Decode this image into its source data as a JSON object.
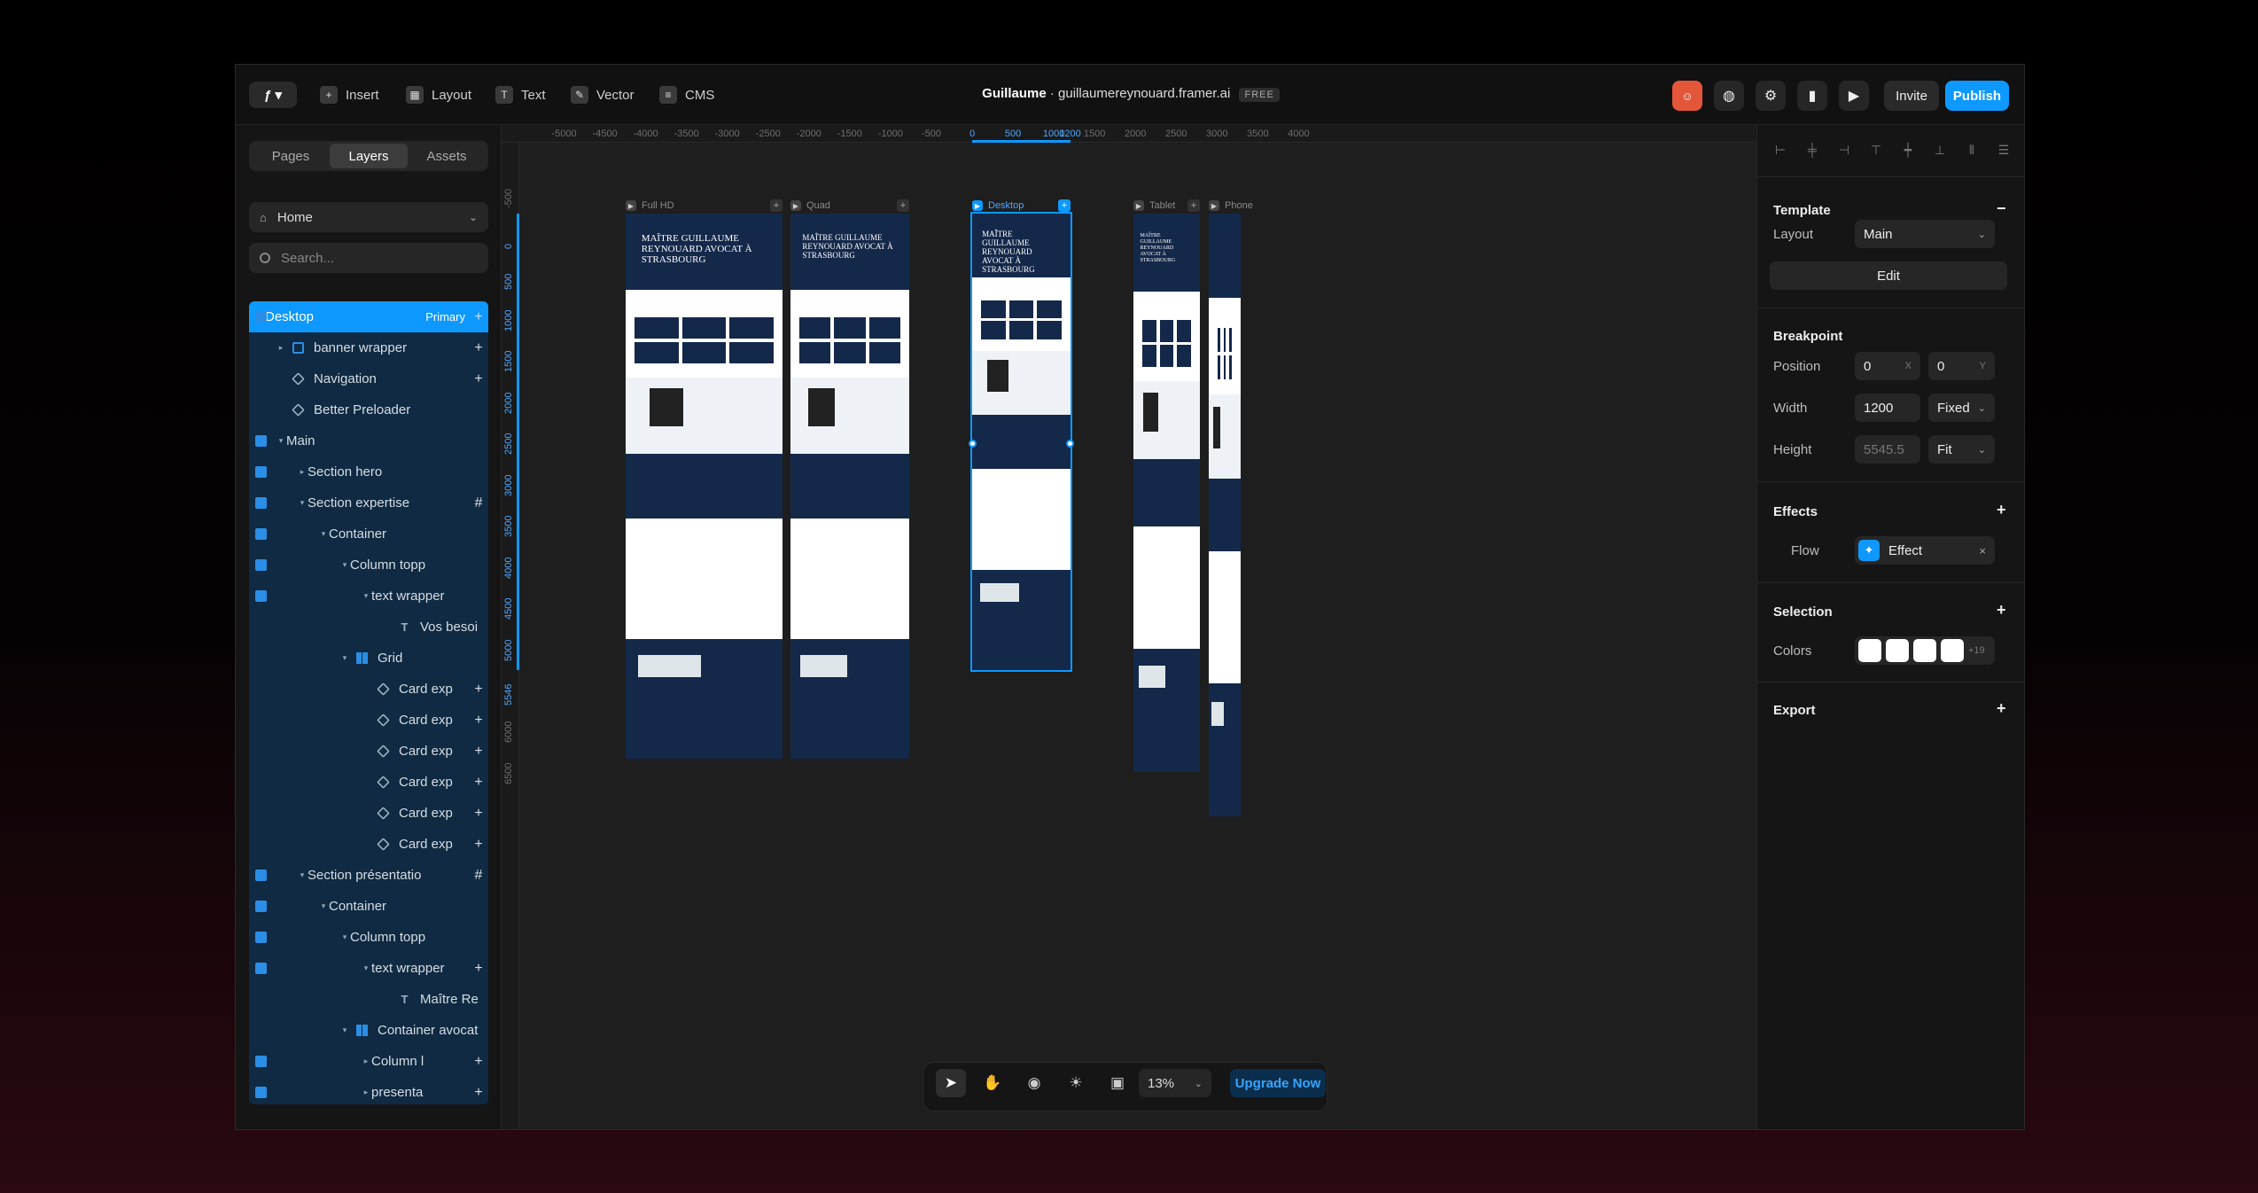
{
  "topbar": {
    "insert": "Insert",
    "layout": "Layout",
    "text": "Text",
    "vector": "Vector",
    "cms": "CMS",
    "project_name": "Guillaume",
    "separator": "·",
    "domain": "guillaumereynouard.framer.ai",
    "plan_badge": "FREE",
    "invite": "Invite",
    "publish": "Publish"
  },
  "left_panel": {
    "tabs": [
      "Pages",
      "Layers",
      "Assets"
    ],
    "active_tab": "Layers",
    "page_selector": "Home",
    "search_placeholder": "Search...",
    "layers": [
      {
        "label": "Desktop",
        "badge": "Primary",
        "icon": "frame-icon",
        "selected": true
      },
      {
        "label": "banner wrapper",
        "icon": "stack-icon"
      },
      {
        "label": "Navigation",
        "icon": "component-icon"
      },
      {
        "label": "Better Preloader",
        "icon": "component-icon"
      },
      {
        "label": "Main",
        "icon": "frame-icon"
      },
      {
        "label": "Section hero",
        "icon": "frame-icon"
      },
      {
        "label": "Section expertise",
        "icon": "frame-icon"
      },
      {
        "label": "Container",
        "icon": "frame-icon"
      },
      {
        "label": "Column topp",
        "icon": "frame-icon"
      },
      {
        "label": "text wrapper",
        "icon": "frame-icon"
      },
      {
        "label": "Vos besoi",
        "icon": "text-icon"
      },
      {
        "label": "Grid",
        "icon": "grid-icon"
      },
      {
        "label": "Card exp",
        "icon": "component-icon"
      },
      {
        "label": "Card exp",
        "icon": "component-icon"
      },
      {
        "label": "Card exp",
        "icon": "component-icon"
      },
      {
        "label": "Card exp",
        "icon": "component-icon"
      },
      {
        "label": "Card exp",
        "icon": "component-icon"
      },
      {
        "label": "Card exp",
        "icon": "component-icon"
      },
      {
        "label": "Section présentatio",
        "icon": "frame-icon"
      },
      {
        "label": "Container",
        "icon": "frame-icon"
      },
      {
        "label": "Column topp",
        "icon": "frame-icon"
      },
      {
        "label": "text wrapper",
        "icon": "frame-icon"
      },
      {
        "label": "Maître Re",
        "icon": "text-icon"
      },
      {
        "label": "Container avocat",
        "icon": "grid-icon"
      },
      {
        "label": "Column l",
        "icon": "frame-icon"
      },
      {
        "label": "presenta",
        "icon": "frame-icon"
      }
    ]
  },
  "canvas": {
    "ruler_x": [
      "-5000",
      "-4500",
      "-4000",
      "-3500",
      "-3000",
      "-2500",
      "-2000",
      "-1500",
      "-1000",
      "-500",
      "0",
      "500",
      "1000",
      "1200",
      "1500",
      "2000",
      "2500",
      "3000",
      "3500",
      "4000"
    ],
    "ruler_y": [
      "-500",
      "0",
      "500",
      "1000",
      "1500",
      "2000",
      "2500",
      "3000",
      "3500",
      "4000",
      "4500",
      "5000",
      "5546",
      "6000",
      "6500"
    ],
    "breakpoints": [
      "Full HD",
      "Quad",
      "Desktop",
      "Tablet",
      "Phone"
    ],
    "hero_text": "MAÎTRE GUILLAUME REYNOUARD AVOCAT À STRASBOURG",
    "zoom": "13%",
    "upgrade": "Upgrade Now"
  },
  "right_panel": {
    "template": "Template",
    "layout_label": "Layout",
    "layout_value": "Main",
    "edit": "Edit",
    "breakpoint": "Breakpoint",
    "position_label": "Position",
    "position_x": "0",
    "position_y": "0",
    "axis_x": "X",
    "axis_y": "Y",
    "width_label": "Width",
    "width_value": "1200",
    "width_mode": "Fixed",
    "height_label": "Height",
    "height_value": "5545.5",
    "height_mode": "Fit",
    "effects": "Effects",
    "flow_label": "Flow",
    "flow_value": "Effect",
    "selection": "Selection",
    "colors_label": "Colors",
    "colors_more": "+19",
    "export": "Export"
  },
  "colors": {
    "accent": "#0d99ff",
    "navy": "#14284a",
    "layer_panel": "#0f2a42"
  }
}
